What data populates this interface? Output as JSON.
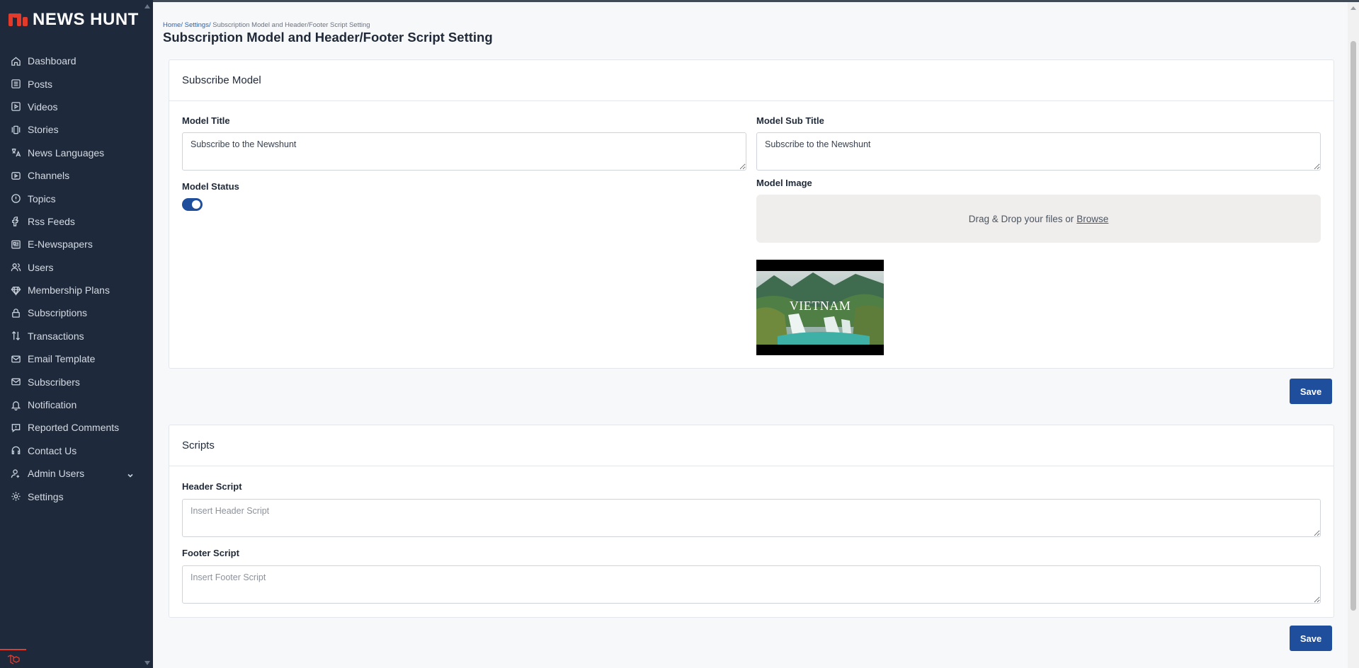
{
  "app": {
    "name": "NEWS HUNT"
  },
  "sidebar": {
    "items": [
      {
        "label": "Dashboard",
        "icon": "home-icon"
      },
      {
        "label": "Posts",
        "icon": "list-icon"
      },
      {
        "label": "Videos",
        "icon": "play-icon"
      },
      {
        "label": "Stories",
        "icon": "stories-icon"
      },
      {
        "label": "News Languages",
        "icon": "translate-icon"
      },
      {
        "label": "Channels",
        "icon": "channel-icon"
      },
      {
        "label": "Topics",
        "icon": "info-icon"
      },
      {
        "label": "Rss Feeds",
        "icon": "rss-icon"
      },
      {
        "label": "E-Newspapers",
        "icon": "newspaper-icon"
      },
      {
        "label": "Users",
        "icon": "users-icon"
      },
      {
        "label": "Membership Plans",
        "icon": "diamond-icon"
      },
      {
        "label": "Subscriptions",
        "icon": "lock-icon"
      },
      {
        "label": "Transactions",
        "icon": "transfer-icon"
      },
      {
        "label": "Email Template",
        "icon": "mail-icon"
      },
      {
        "label": "Subscribers",
        "icon": "mail-icon"
      },
      {
        "label": "Notification",
        "icon": "bell-icon"
      },
      {
        "label": "Reported Comments",
        "icon": "comment-icon"
      },
      {
        "label": "Contact Us",
        "icon": "headset-icon"
      },
      {
        "label": "Admin Users",
        "icon": "admin-user-icon"
      },
      {
        "label": "Settings",
        "icon": "gear-icon"
      }
    ]
  },
  "breadcrumb": {
    "home": "Home/",
    "settings": "Settings/",
    "current": "Subscription Model and Header/Footer Script Setting"
  },
  "page": {
    "title": "Subscription Model and Header/Footer Script Setting"
  },
  "subscribe_model": {
    "title": "Subscribe Model",
    "model_title_label": "Model Title",
    "model_title_value": "Subscribe to the Newshunt",
    "model_sub_title_label": "Model Sub Title",
    "model_sub_title_value": "Subscribe to the Newshunt",
    "model_status_label": "Model Status",
    "model_status_on": true,
    "model_image_label": "Model Image",
    "dropzone_text": "Drag & Drop your files or",
    "dropzone_browse": "Browse",
    "preview_caption": "VIETNAM",
    "save_label": "Save"
  },
  "scripts": {
    "title": "Scripts",
    "header_label": "Header Script",
    "header_placeholder": "Insert Header Script",
    "footer_label": "Footer Script",
    "footer_placeholder": "Insert Footer Script",
    "save_label": "Save"
  },
  "colors": {
    "sidebar_bg": "#1e2a3b",
    "brand_red": "#e23b2c",
    "primary_button": "#1f4e9c",
    "breadcrumb_link": "#2563b8"
  }
}
